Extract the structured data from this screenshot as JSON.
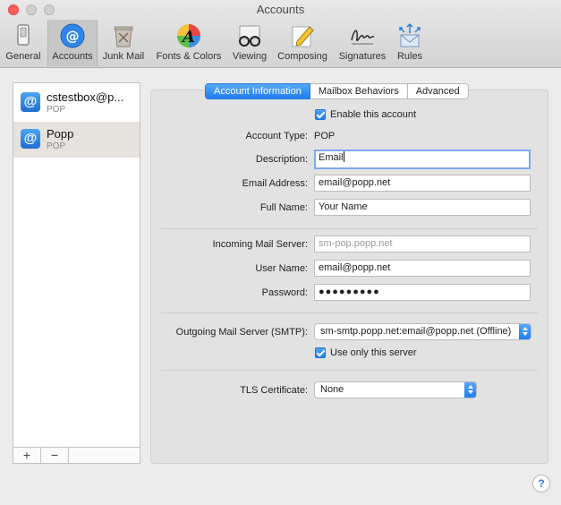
{
  "window": {
    "title": "Accounts"
  },
  "toolbar": {
    "items": [
      {
        "label": "General",
        "icon": "switch-icon"
      },
      {
        "label": "Accounts",
        "icon": "at-sign-icon"
      },
      {
        "label": "Junk Mail",
        "icon": "trash-bin-icon"
      },
      {
        "label": "Fonts & Colors",
        "icon": "font-a-icon"
      },
      {
        "label": "Viewing",
        "icon": "glasses-icon"
      },
      {
        "label": "Composing",
        "icon": "pencil-icon"
      },
      {
        "label": "Signatures",
        "icon": "signature-icon"
      },
      {
        "label": "Rules",
        "icon": "envelope-arrows-icon"
      }
    ],
    "selected": "Accounts"
  },
  "sidebar": {
    "accounts": [
      {
        "name": "cstestbox@p...",
        "type": "POP"
      },
      {
        "name": "Popp",
        "type": "POP"
      }
    ],
    "add_label": "+",
    "remove_label": "−"
  },
  "tabs": [
    {
      "label": "Account Information",
      "active": true
    },
    {
      "label": "Mailbox Behaviors",
      "active": false
    },
    {
      "label": "Advanced",
      "active": false
    }
  ],
  "form": {
    "enable_label": "Enable this account",
    "account_type_label": "Account Type:",
    "account_type_value": "POP",
    "description_label": "Description:",
    "description_value": "Email",
    "email_label": "Email Address:",
    "email_value": "email@popp.net",
    "fullname_label": "Full Name:",
    "fullname_value": "Your Name",
    "incoming_label": "Incoming Mail Server:",
    "incoming_value": "sm-pop.popp.net",
    "username_label": "User Name:",
    "username_value": "email@popp.net",
    "password_label": "Password:",
    "password_value": "●●●●●●●●●",
    "outgoing_label": "Outgoing Mail Server (SMTP):",
    "outgoing_value": "sm-smtp.popp.net:email@popp.net (Offline)",
    "only_server_label": "Use only this server",
    "tls_label": "TLS Certificate:",
    "tls_value": "None"
  },
  "help": {
    "label": "?"
  },
  "colors": {
    "accent": "#1e7cf1",
    "close": "#fc605c"
  }
}
